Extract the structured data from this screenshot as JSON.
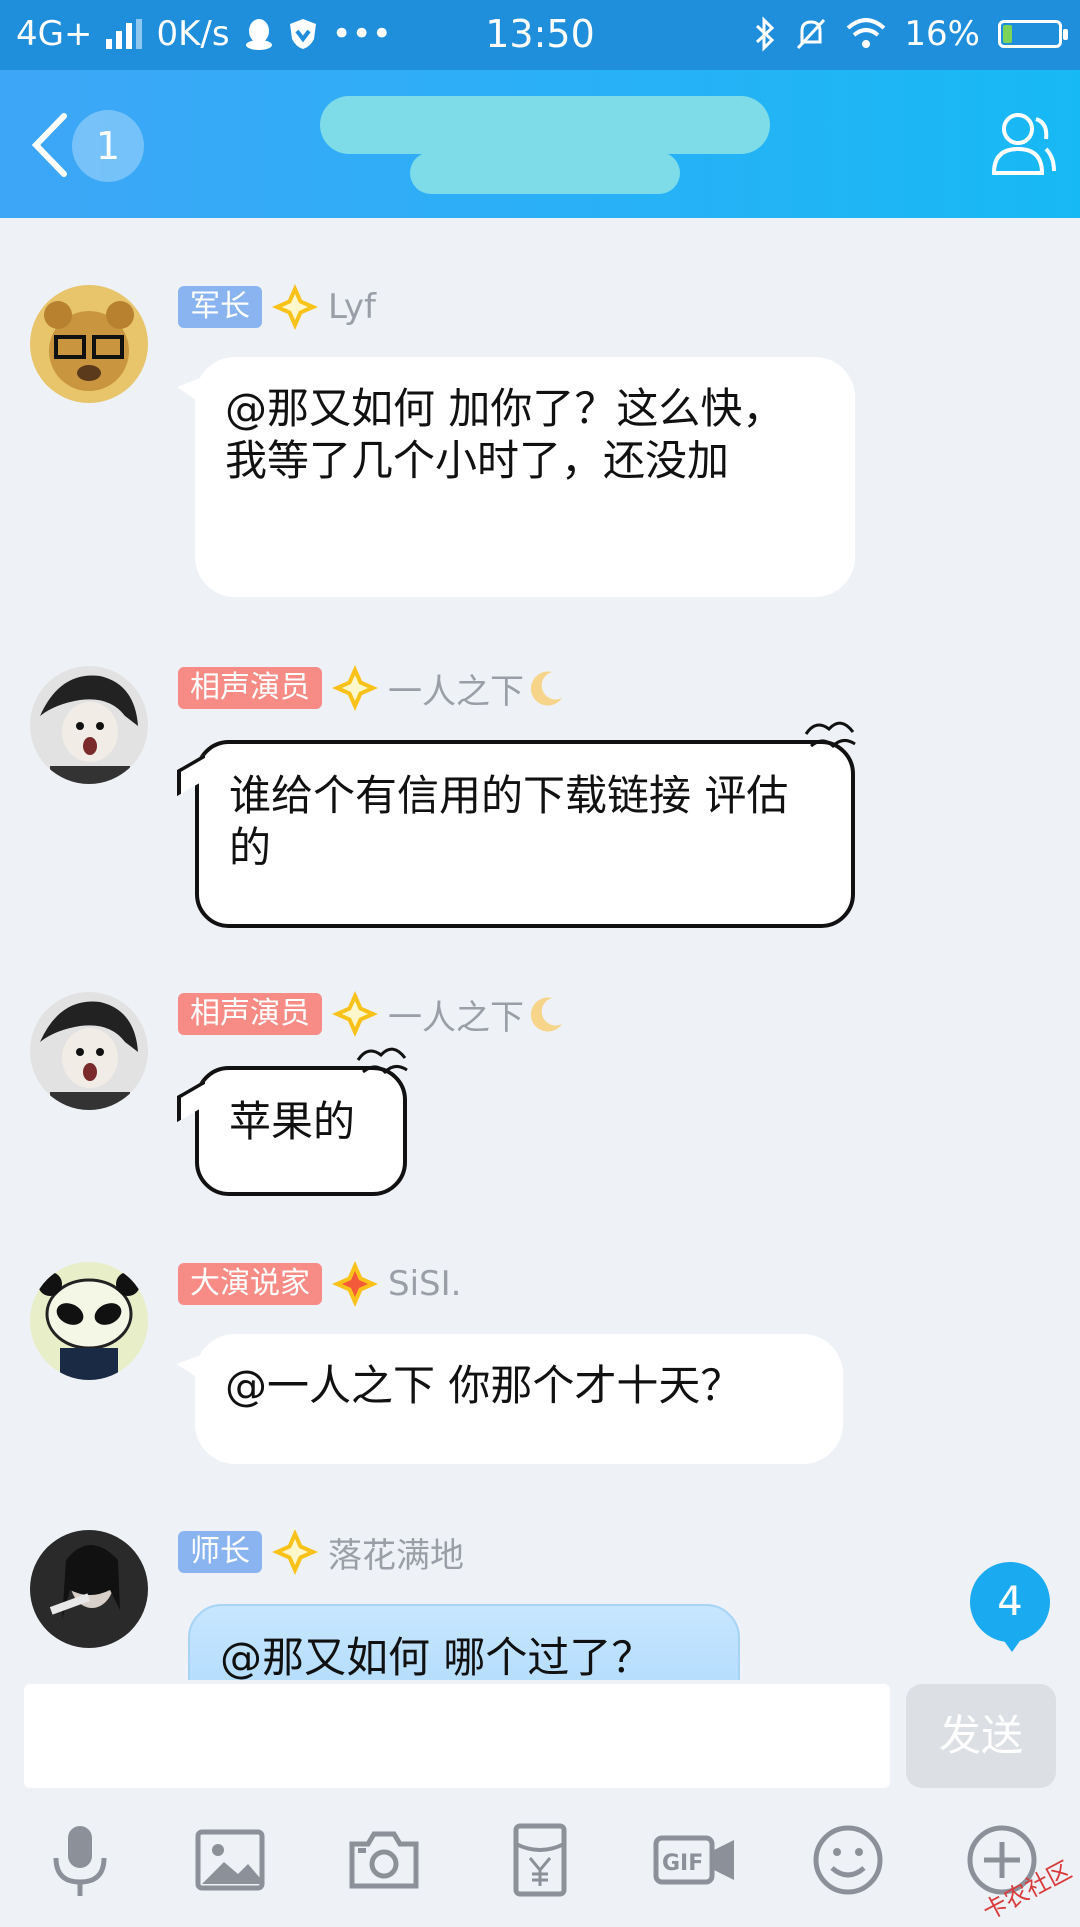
{
  "status_bar": {
    "network": "4G+",
    "speed": "0K/s",
    "time": "13:50",
    "battery": "16%",
    "battery_level": 0.16
  },
  "header": {
    "unread_count": "1"
  },
  "messages": [
    {
      "badge": "军长",
      "badge_color": "#8ab4ef",
      "nick": "Lyf",
      "text": "@那又如何 加你了？这么快，我等了几个小时了，还没加"
    },
    {
      "badge": "相声演员",
      "badge_color": "#f78b86",
      "nick": "一人之下",
      "text": "谁给个有信用的下载链接 评估的"
    },
    {
      "badge": "相声演员",
      "badge_color": "#f78b86",
      "nick": "一人之下",
      "text": "苹果的"
    },
    {
      "badge": "大演说家",
      "badge_color": "#f78b86",
      "nick": "SiSI.",
      "text": "@一人之下 你那个才十天？"
    },
    {
      "badge": "师长",
      "badge_color": "#8ab4ef",
      "nick": "落花满地",
      "text": "@那又如何 哪个过了？"
    }
  ],
  "new_message_count": "4",
  "input": {
    "placeholder": "",
    "send_label": "发送"
  },
  "toolbar_icons": [
    "microphone-icon",
    "image-icon",
    "camera-icon",
    "red-packet-icon",
    "gif-icon",
    "emoji-icon",
    "plus-icon"
  ],
  "watermark": "卡农社区"
}
